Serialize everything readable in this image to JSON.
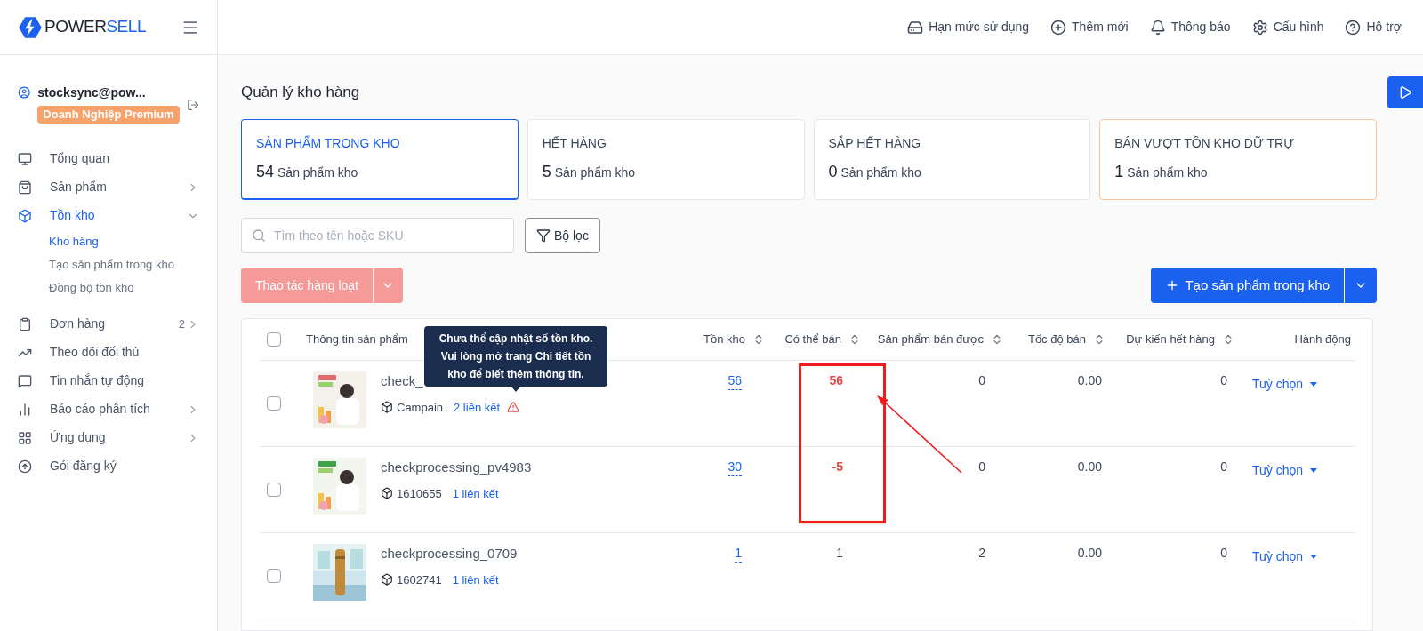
{
  "brand": {
    "left": "POWER",
    "right": "SELL"
  },
  "topbar": [
    {
      "label": "Hạn mức sử dụng"
    },
    {
      "label": "Thêm mới"
    },
    {
      "label": "Thông báo"
    },
    {
      "label": "Cấu hình"
    },
    {
      "label": "Hỗ trợ"
    }
  ],
  "user": {
    "email": "stocksync@pow...",
    "plan": "Doanh Nghiệp Premium"
  },
  "sidebar": {
    "items": [
      {
        "label": "Tổng quan",
        "selected": false
      },
      {
        "label": "Sản phẩm",
        "selected": false,
        "expanded": false
      },
      {
        "label": "Tồn kho",
        "selected": true,
        "expanded": true,
        "children": [
          {
            "label": "Kho hàng",
            "selected": true
          },
          {
            "label": "Tạo sản phẩm trong kho",
            "selected": false
          },
          {
            "label": "Đồng bộ tồn kho",
            "selected": false
          }
        ]
      },
      {
        "label": "Đơn hàng",
        "selected": false,
        "expanded": false,
        "count": "2"
      },
      {
        "label": "Theo dõi đối thủ",
        "selected": false
      },
      {
        "label": "Tin nhắn tự động",
        "selected": false
      },
      {
        "label": "Báo cáo phân tích",
        "selected": false,
        "expanded": false
      },
      {
        "label": "Ứng dụng",
        "selected": false,
        "expanded": false
      },
      {
        "label": "Gói đăng ký",
        "selected": false
      }
    ]
  },
  "page_title": "Quản lý kho hàng",
  "stat_cards": [
    {
      "title": "SẢN PHẨM TRONG KHO",
      "count": "54",
      "unit": "Sản phẩm kho",
      "selected": true,
      "kind": "normal"
    },
    {
      "title": "HẾT HÀNG",
      "count": "5",
      "unit": "Sản phẩm kho",
      "selected": false,
      "kind": "normal"
    },
    {
      "title": "SẮP HẾT HÀNG",
      "count": "0",
      "unit": "Sản phẩm kho",
      "selected": false,
      "kind": "normal"
    },
    {
      "title": "BÁN VƯỢT TỒN KHO DỮ TRỰ",
      "count": "1",
      "unit": "Sản phẩm kho",
      "selected": false,
      "kind": "warning"
    }
  ],
  "search": {
    "placeholder": "Tìm theo tên hoặc SKU"
  },
  "filter_button": "Bộ lọc",
  "bulk_button": {
    "label": "Thao tác hàng loạt",
    "disabled": true
  },
  "create_button": "Tạo sản phẩm trong kho",
  "table": {
    "all_checked": false,
    "columns": [
      "Thông tin sản phẩm",
      "Tồn kho",
      "Có thể bán",
      "Sản phẩm bán được",
      "Tốc độ bán",
      "Dự kiến hết hàng",
      "Hành động"
    ],
    "rows": [
      {
        "name": "check_",
        "sku": "Campain",
        "links": "2 liên kết",
        "warning": true,
        "stock": "56",
        "available": "56",
        "available_alert": true,
        "sold": "0",
        "speed": "0.00",
        "eta": "0",
        "action": "Tuỳ chọn",
        "checked": false
      },
      {
        "name": "checkprocessing_pv4983",
        "sku": "1610655",
        "links": "1 liên kết",
        "warning": false,
        "stock": "30",
        "available": "-5",
        "available_alert": true,
        "sold": "0",
        "speed": "0.00",
        "eta": "0",
        "action": "Tuỳ chọn",
        "checked": false
      },
      {
        "name": "checkprocessing_0709",
        "sku": "1602741",
        "links": "1 liên kết",
        "warning": false,
        "stock": "1",
        "available": "1",
        "available_alert": false,
        "sold": "2",
        "speed": "0.00",
        "eta": "0",
        "action": "Tuỳ chọn",
        "checked": false
      }
    ]
  },
  "tooltip": "Chưa thể cập nhật số tồn kho. Vui lòng mở trang Chi tiết tồn kho để biết thêm thông tin."
}
